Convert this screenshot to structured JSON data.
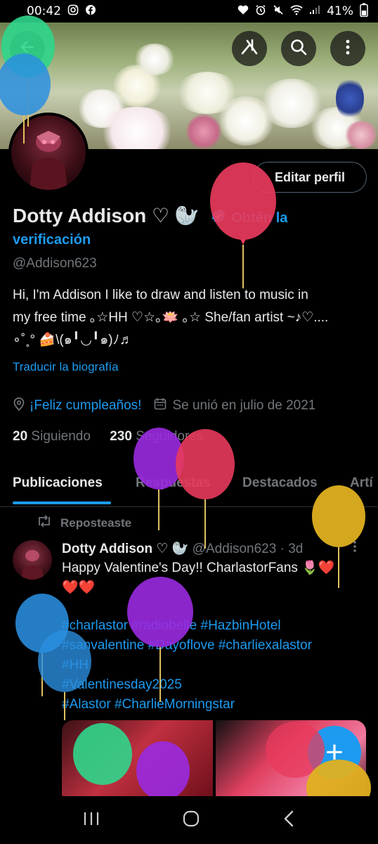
{
  "status_bar": {
    "time": "00:42",
    "battery": "41%"
  },
  "profile": {
    "edit_button": "Editar perfil",
    "name": "Dotty Addison ♡ 🦭",
    "verify_prefix": "Obtén la",
    "verify_suffix": "verificación",
    "handle": "@Addison623",
    "bio_line1": "Hi, I'm Addison I like to draw and listen to music in",
    "bio_line2": "my free time ｡☆HH ♡☆｡🪷 ｡☆ She/fan artist ~♪♡....",
    "bio_line3": "∘˚˳° 🍰\\(๑╹◡╹๑)ﾉ♬",
    "translate": "Traducir la biografía",
    "birthday": "¡Feliz cumpleaños!",
    "joined": "Se unió en julio de 2021",
    "following_count": "20",
    "following_label": "Siguiendo",
    "followers_count": "230",
    "followers_label": "Seguidores"
  },
  "tabs": [
    "Publicaciones",
    "Respuestas",
    "Destacados",
    "Artí"
  ],
  "post": {
    "repost_label": "Reposteaste",
    "author": "Dotty Addison ♡ 🦭",
    "handle": "@Addison623",
    "time": "· 3d",
    "text_line1": "Happy Valentine's Day!! CharlastorFans 🌷❤️",
    "text_line2": "❤️❤️",
    "tags": [
      "#charlastor #radiobelle #HazbinHotel",
      "#sanvalentine #Dayoflove #charliexalastor",
      "#HH",
      "#Valentinesday2025",
      "#Alastor #CharlieMorningstar"
    ]
  },
  "fab_label": "+",
  "icons": {
    "back": "arrow-left-icon",
    "grok": "grok-icon",
    "search": "search-icon",
    "more": "more-vertical-icon",
    "verified": "verified-badge-icon",
    "location": "location-pin-icon",
    "calendar": "calendar-icon",
    "repost": "repost-icon",
    "nav_recent": "recent-apps-icon",
    "nav_home": "home-icon",
    "nav_back": "nav-back-icon"
  },
  "colors": {
    "accent": "#1d9bf0",
    "muted": "#71767b",
    "text": "#e7e9ea",
    "background": "#000000"
  }
}
